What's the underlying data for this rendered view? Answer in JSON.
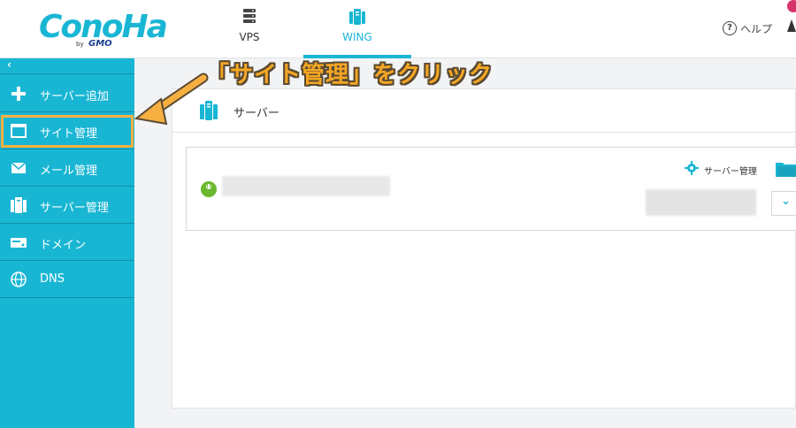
{
  "header": {
    "logo_text": "ConoHa",
    "logo_by": "by",
    "logo_gmo": "GMO",
    "tabs": [
      {
        "label": "VPS",
        "icon": "server-stack-icon",
        "active": false
      },
      {
        "label": "WING",
        "icon": "wing-server-icon",
        "active": true
      }
    ],
    "help_label": "ヘルプ",
    "help_icon_char": "?",
    "accent_color": "#19b6d4"
  },
  "sidebar": {
    "collapse_label": "‹",
    "items": [
      {
        "label": "サーバー追加",
        "icon": "plus-icon"
      },
      {
        "label": "サイト管理",
        "icon": "window-icon",
        "highlighted": true
      },
      {
        "label": "メール管理",
        "icon": "mail-icon"
      },
      {
        "label": "サーバー管理",
        "icon": "server-icon"
      },
      {
        "label": "ドメイン",
        "icon": "domain-card-icon"
      },
      {
        "label": "DNS",
        "icon": "globe-icon"
      }
    ]
  },
  "main": {
    "section_title": "サーバー",
    "server_card": {
      "manage_label": "サーバー管理",
      "status": "running",
      "dropdown_char": "⌄"
    }
  },
  "annotation": {
    "text": "「サイト管理」をクリック",
    "color": "#f5a623"
  }
}
